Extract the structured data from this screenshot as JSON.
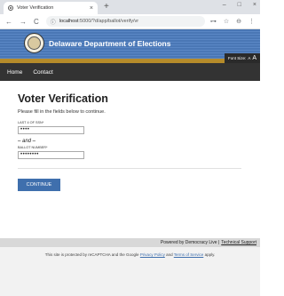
{
  "browser": {
    "tab_title": "Voter Verification",
    "tab_close": "×",
    "new_tab": "+",
    "win_min": "–",
    "win_max": "□",
    "win_close": "×",
    "back": "←",
    "forward": "→",
    "reload": "C",
    "url_host": "localhost",
    "url_path": ":5000/?d/app/ballot/verify/vr",
    "key_icon": "⊶",
    "star_icon": "☆",
    "profile_icon": "⊖",
    "menu_icon": "⋮"
  },
  "site": {
    "title": "Delaware Department of Elections",
    "font_size_label": "Font Size:",
    "font_small": "A",
    "font_large": "A"
  },
  "nav": {
    "home": "Home",
    "contact": "Contact"
  },
  "form": {
    "title": "Voter Verification",
    "intro": "Please fill in the fields below to continue.",
    "ssn_label": "LAST 4 OF SSN*",
    "ssn_value": "••••",
    "and_text": "– and –",
    "ballot_label": "BALLOT NUMBER*",
    "ballot_value": "••••••••",
    "continue_label": "CONTINUE"
  },
  "footer": {
    "powered_by": "Powered by Democracy Live |",
    "support_link": "Technical Support",
    "recaptcha_prefix": "This site is protected by reCAPTCHA and the Google",
    "privacy_link": "Privacy Policy",
    "and_word": "and",
    "terms_link": "Terms of Service",
    "recaptcha_suffix": "apply."
  }
}
